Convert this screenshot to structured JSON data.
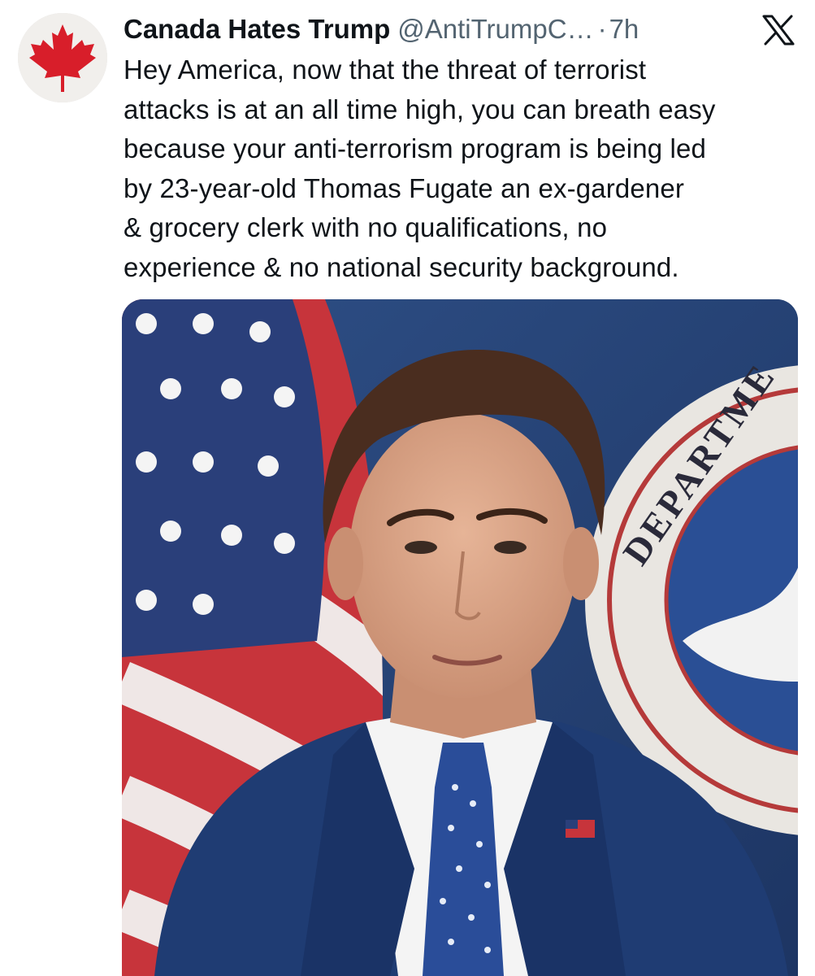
{
  "tweet": {
    "author": {
      "display_name": "Canada Hates Trump",
      "handle": "@AntiTrumpC…",
      "avatar_icon": "maple-leaf-icon"
    },
    "separator": "·",
    "timestamp": "7h",
    "platform_icon": "x-logo-icon",
    "text": "Hey America, now that the threat of terrorist\nattacks is at an all time high, you can breath easy\nbecause your anti-terrorism program is being led\nby 23-year-old Thomas Fugate an ex-gardener\n& grocery clerk with no qualifications, no\nexperience & no national security background.",
    "media": {
      "type": "photo",
      "seal_text": "DEPARTME"
    }
  },
  "colors": {
    "text_primary": "#0f1419",
    "text_secondary": "#536471",
    "maple_red": "#d81e2a",
    "suit_navy": "#1f3c73"
  }
}
